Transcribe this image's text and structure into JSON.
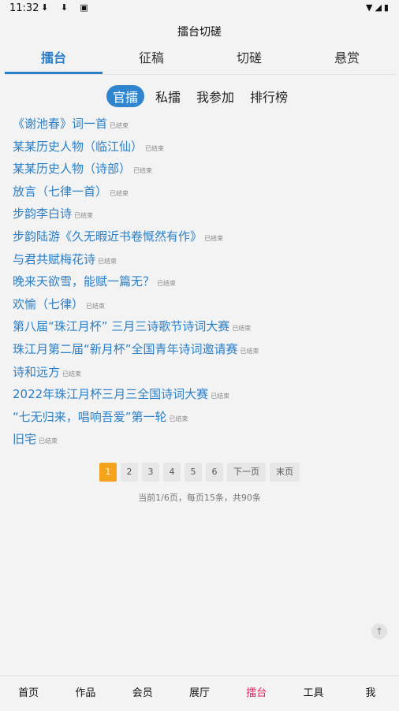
{
  "status_bar": {
    "time": "11:32",
    "left_icons": "⬇ ⬇ ▣",
    "right_icons": "▼◢▮"
  },
  "app_title": "擂台切磋",
  "top_tabs": [
    "擂台",
    "征稿",
    "切磋",
    "悬赏"
  ],
  "top_tab_active": 0,
  "sub_tabs": [
    "官擂",
    "私擂",
    "我参加",
    "排行榜"
  ],
  "sub_tab_active": 0,
  "items": [
    {
      "title": "《谢池春》词一首",
      "status": "已结束"
    },
    {
      "title": "某某历史人物（临江仙）",
      "status": "已结束"
    },
    {
      "title": "某某历史人物（诗部）",
      "status": "已结束"
    },
    {
      "title": "放言（七律一首）",
      "status": "已结束"
    },
    {
      "title": "步韵李白诗",
      "status": "已结束"
    },
    {
      "title": "步韵陆游《久无暇近书卷慨然有作》",
      "status": "已结束"
    },
    {
      "title": "与君共赋梅花诗",
      "status": "已结束"
    },
    {
      "title": "晚来天欲雪，能赋一篇无？",
      "status": "已结束"
    },
    {
      "title": "欢愉（七律）",
      "status": "已结束"
    },
    {
      "title": "第八届“珠江月杯” 三月三诗歌节诗词大赛",
      "status": "已结束"
    },
    {
      "title": "珠江月第二届“新月杯”全国青年诗词邀请赛",
      "status": "已结束"
    },
    {
      "title": "诗和远方",
      "status": "已结束"
    },
    {
      "title": "2022年珠江月杯三月三全国诗词大赛",
      "status": "已结束"
    },
    {
      "title": "“七无归来，唱响吾爱”第一轮",
      "status": "已结束"
    },
    {
      "title": "旧宅",
      "status": "已结束"
    }
  ],
  "pagination": {
    "pages": [
      "1",
      "2",
      "3",
      "4",
      "5",
      "6"
    ],
    "current": 0,
    "next_label": "下一页",
    "last_label": "末页",
    "info": "当前1/6页，每页15条，共90条"
  },
  "scroll_top_icon": "arrow-up-icon",
  "bottom_nav": [
    "首页",
    "作品",
    "会员",
    "展厅",
    "擂台",
    "工具",
    "我"
  ],
  "bottom_nav_active": 4,
  "colors": {
    "accent": "#2a7fc8",
    "page_active": "#f5a21c",
    "nav_active": "#e0245e"
  }
}
